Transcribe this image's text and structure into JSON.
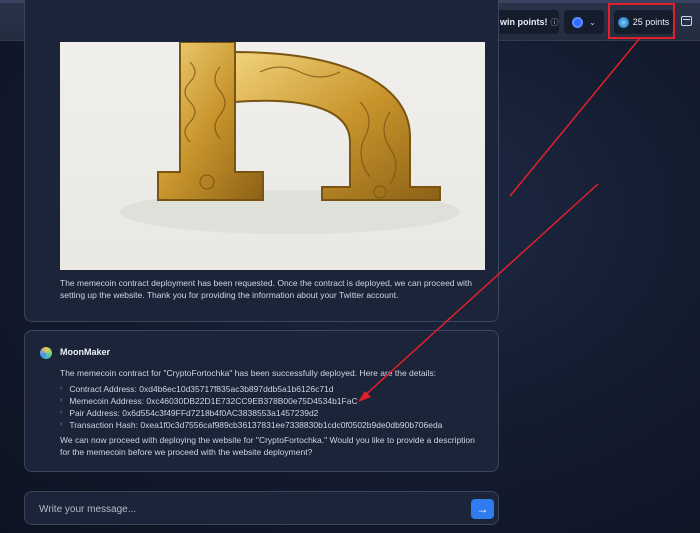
{
  "topbar": {
    "refer_label": "Refer to win points!",
    "info_icon": "info-circle-icon",
    "chain_icon": "chain-selector-icon",
    "points_label": "25 points"
  },
  "assistant_image": {
    "alt": "Ornate golden letter B sculpture"
  },
  "message1": {
    "text": "The memecoin contract deployment has been requested. Once the contract is deployed, we can proceed with setting up the website. Thank you for providing the information about your Twitter account."
  },
  "message2": {
    "sender": "MoonMaker",
    "intro": "The memecoin contract for \"CryptoFortochka\" has been successfully deployed. Here are the details:",
    "details": [
      "Contract Address: 0xd4b6ec10d35717f835ac3b897ddb5a1b6126c71d",
      "Memecoin Address: 0xc46030DB22D1E732CC9EB378B00e75D4534b1FaC",
      "Pair Address: 0x6d554c3f49FFd7218b4f0AC3838553a1457239d2",
      "Transaction Hash: 0xea1f0c3d7556caf989cb36137831ee7338830b1cdc0f0502b9de0db90b706eda"
    ],
    "outro": "We can now proceed with deploying the website for \"CryptoFortochka.\" Would you like to provide a description for the memecoin before we proceed with the website deployment?"
  },
  "composer": {
    "placeholder": "Write your message...",
    "send_icon": "arrow-right-icon"
  },
  "colors": {
    "accent": "#2f7bf0",
    "annotation_red": "#e3202a",
    "card_bg": "#1b2438"
  }
}
